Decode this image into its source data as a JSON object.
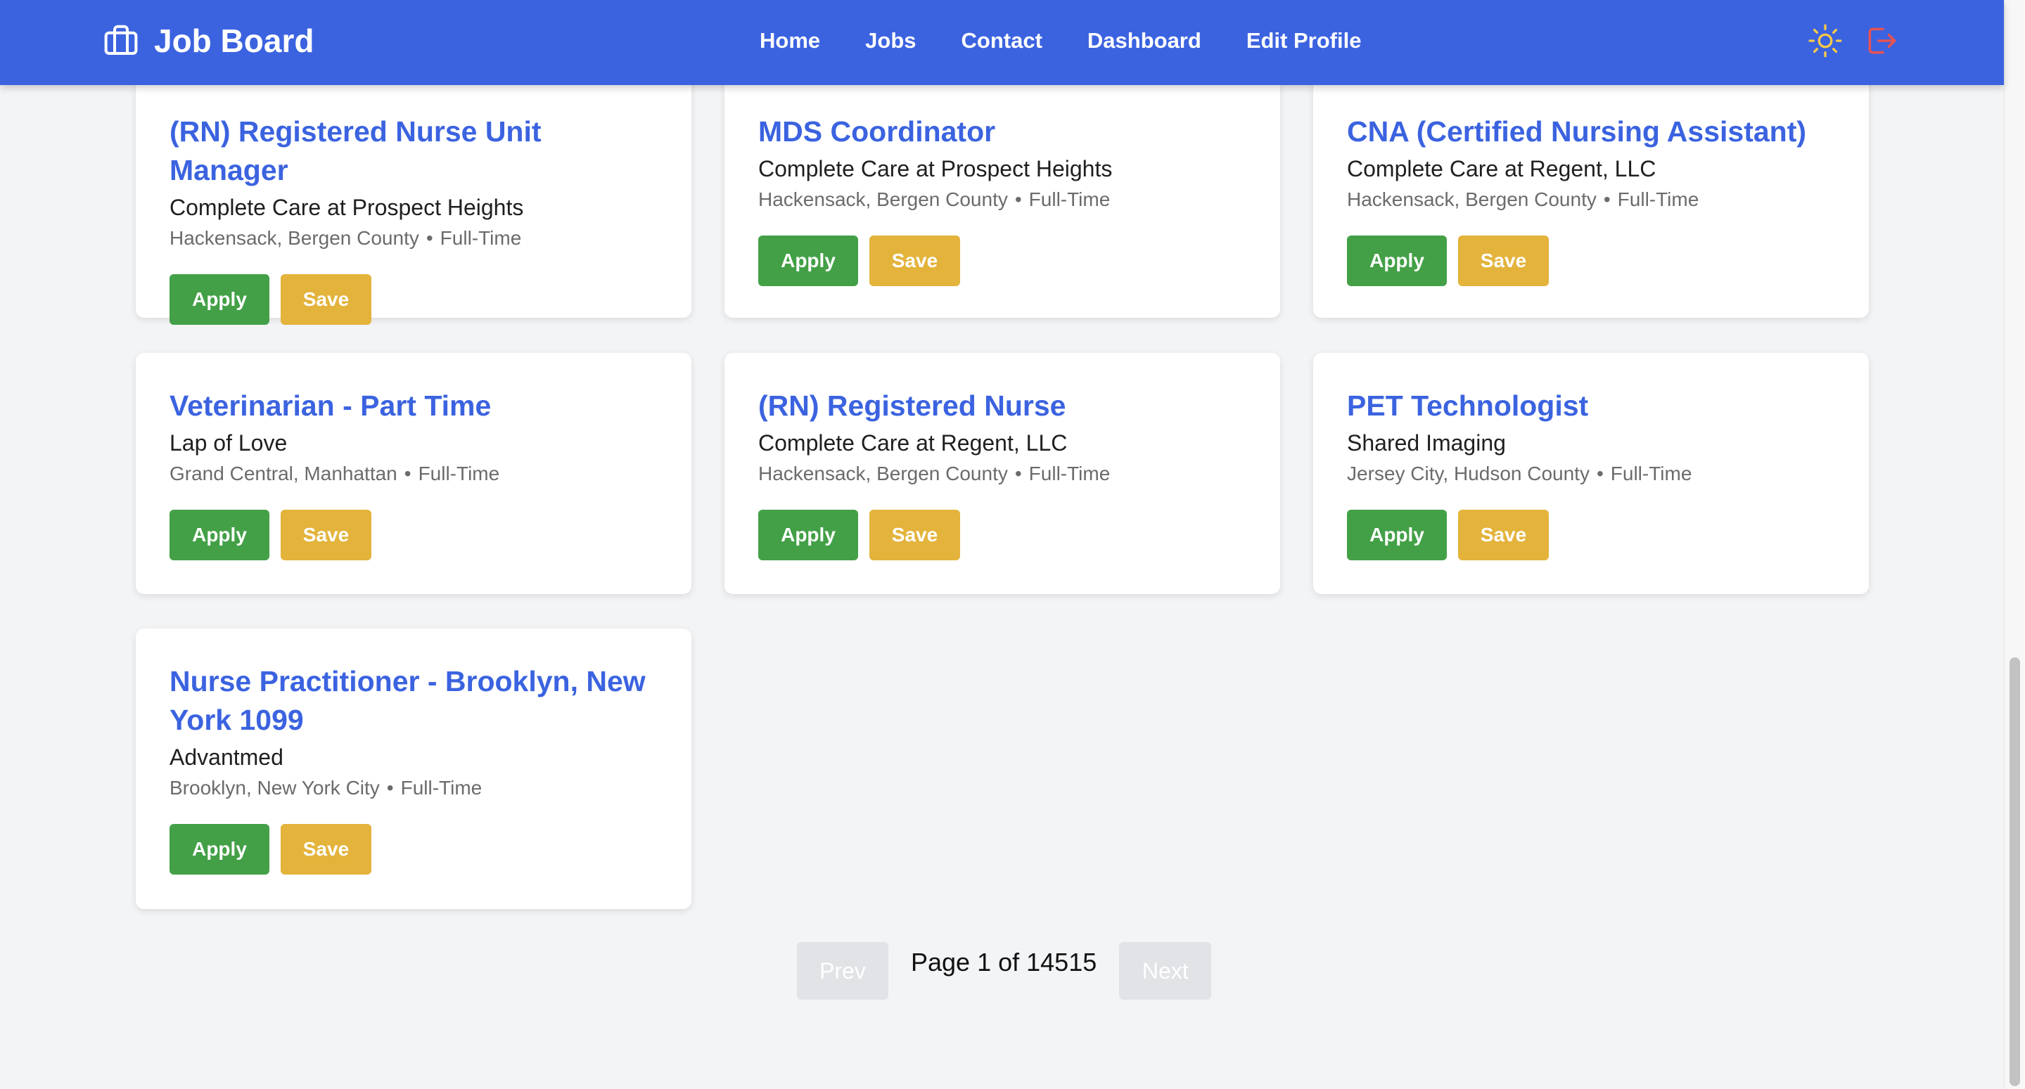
{
  "app": {
    "brand": "Job Board",
    "brand_icon": "briefcase-icon"
  },
  "nav": {
    "links": [
      "Home",
      "Jobs",
      "Contact",
      "Dashboard",
      "Edit Profile"
    ],
    "theme_icon": "sun-icon",
    "logout_icon": "logout-icon",
    "theme_icon_color": "#f7c948",
    "logout_icon_color": "#e55353"
  },
  "colors": {
    "nav_bg": "#3b63e0",
    "title": "#3b63e0",
    "apply": "#43a047",
    "save": "#e3b33b"
  },
  "buttons": {
    "apply": "Apply",
    "save": "Save"
  },
  "jobs": [
    {
      "title": "(RN) Registered Nurse Unit Manager",
      "company": "Complete Care at Prospect Heights",
      "location": "Hackensack, Bergen County",
      "type": "Full-Time"
    },
    {
      "title": "MDS Coordinator",
      "company": "Complete Care at Prospect Heights",
      "location": "Hackensack, Bergen County",
      "type": "Full-Time"
    },
    {
      "title": "CNA (Certified Nursing Assistant)",
      "company": "Complete Care at Regent, LLC",
      "location": "Hackensack, Bergen County",
      "type": "Full-Time"
    },
    {
      "title": "Veterinarian - Part Time",
      "company": "Lap of Love",
      "location": "Grand Central, Manhattan",
      "type": "Full-Time"
    },
    {
      "title": "(RN) Registered Nurse",
      "company": "Complete Care at Regent, LLC",
      "location": "Hackensack, Bergen County",
      "type": "Full-Time"
    },
    {
      "title": "PET Technologist",
      "company": "Shared Imaging",
      "location": "Jersey City, Hudson County",
      "type": "Full-Time"
    },
    {
      "title": "Nurse Practitioner - Brooklyn, New York 1099",
      "company": "Advantmed",
      "location": "Brooklyn, New York City",
      "type": "Full-Time"
    }
  ],
  "pagination": {
    "prev": "Prev",
    "next": "Next",
    "info": "Page 1 of 14515"
  }
}
